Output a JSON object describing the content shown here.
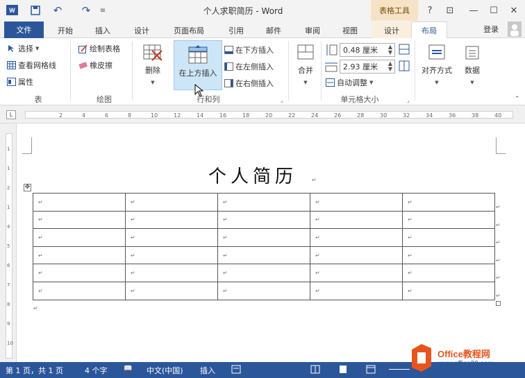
{
  "window": {
    "title": "个人求职简历 - Word",
    "contextual_group": "表格工具",
    "help": "?",
    "restore": "⊡",
    "minimize": "—",
    "maximize": "☐",
    "close": "✕"
  },
  "tabs": [
    "文件",
    "开始",
    "插入",
    "设计",
    "页面布局",
    "引用",
    "邮件",
    "审阅",
    "视图",
    "设计",
    "布局"
  ],
  "account": {
    "login": "登录"
  },
  "ribbon": {
    "table_group": {
      "select": "选择",
      "view_gridlines": "查看网格线",
      "properties": "属性",
      "label": "表"
    },
    "draw_group": {
      "draw_table": "绘制表格",
      "eraser": "橡皮擦",
      "label": "绘图"
    },
    "rows_cols_group": {
      "delete": "删除",
      "insert_above": "在上方插入",
      "insert_below": "在下方插入",
      "insert_left": "在左侧插入",
      "insert_right": "在右侧插入",
      "label": "行和列"
    },
    "merge_group": {
      "merge": "合并"
    },
    "cell_size_group": {
      "height": "0.48 厘米",
      "width": "2.93 厘米",
      "autofit": "自动调整",
      "label": "单元格大小"
    },
    "alignment_group": {
      "alignment": "对齐方式"
    },
    "data_group": {
      "data": "数据"
    }
  },
  "ruler": {
    "ticks": [
      "2",
      "4",
      "6",
      "8",
      "10",
      "12",
      "14",
      "16",
      "18",
      "20",
      "22",
      "24",
      "26",
      "28",
      "30",
      "32",
      "34",
      "36",
      "38",
      "40"
    ],
    "vticks": [
      "1",
      "1",
      "2",
      "1",
      "4",
      "5",
      "6",
      "7",
      "8",
      "9",
      "10"
    ]
  },
  "document": {
    "heading": "个人简历",
    "cell_mark": "↵",
    "table": {
      "rows": [
        [
          "↵",
          "↵",
          "↵",
          "↵",
          "↵"
        ],
        [
          "↵",
          "↵",
          "↵",
          "↵",
          "↵"
        ],
        [
          "↵",
          "↵",
          "↵",
          "↵",
          "↵"
        ],
        [
          "↵",
          "↵",
          "↵",
          "↵",
          "↵"
        ],
        [
          "↵",
          "↵",
          "↵",
          "↵",
          "↵"
        ],
        [
          "↵",
          "↵",
          "↵",
          "↵",
          "↵"
        ]
      ]
    }
  },
  "statusbar": {
    "page": "第 1 页，共 1 页",
    "words": "4 个字",
    "language": "中文(中国)",
    "mode": "插入"
  },
  "watermark": {
    "text": "Office教程网",
    "url": "www.office26.com"
  },
  "colors": {
    "accent": "#2b579a",
    "contextual": "#f6e3c6",
    "selected_button": "#cde6f7"
  }
}
